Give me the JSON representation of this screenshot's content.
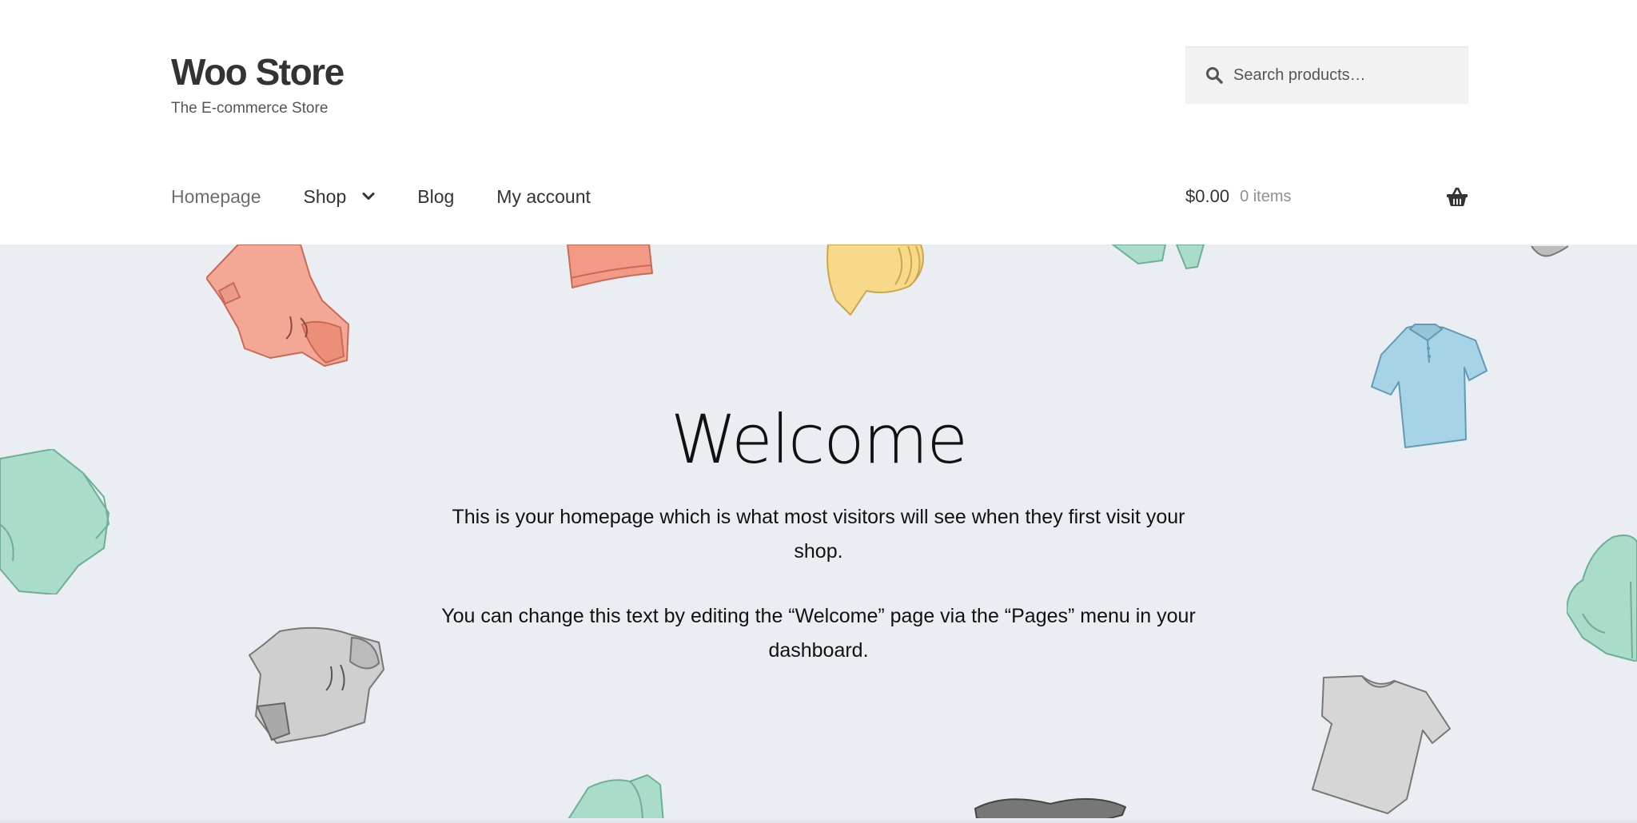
{
  "site": {
    "title": "Woo Store",
    "tagline": "The E-commerce Store"
  },
  "search": {
    "placeholder": "Search products…",
    "value": ""
  },
  "nav": {
    "items": [
      {
        "label": "Homepage",
        "current": true
      },
      {
        "label": "Shop",
        "has_submenu": true
      },
      {
        "label": "Blog"
      },
      {
        "label": "My account"
      }
    ]
  },
  "cart": {
    "amount": "$0.00",
    "count": "0 items"
  },
  "hero": {
    "title": "Welcome",
    "paragraph1": "This is your homepage which is what most visitors will see when they first visit your shop.",
    "paragraph2": "You can change this text by editing the “Welcome” page via the “Pages” menu in your dashboard."
  },
  "icons": {
    "search": "search-icon",
    "submenu": "chevron-down-icon",
    "cart": "basket-icon"
  },
  "colors": {
    "header_bg": "#ffffff",
    "hero_bg": "#eaedf2",
    "text": "#333333",
    "muted": "#6d6d6d",
    "search_bg": "#f2f2f2"
  }
}
